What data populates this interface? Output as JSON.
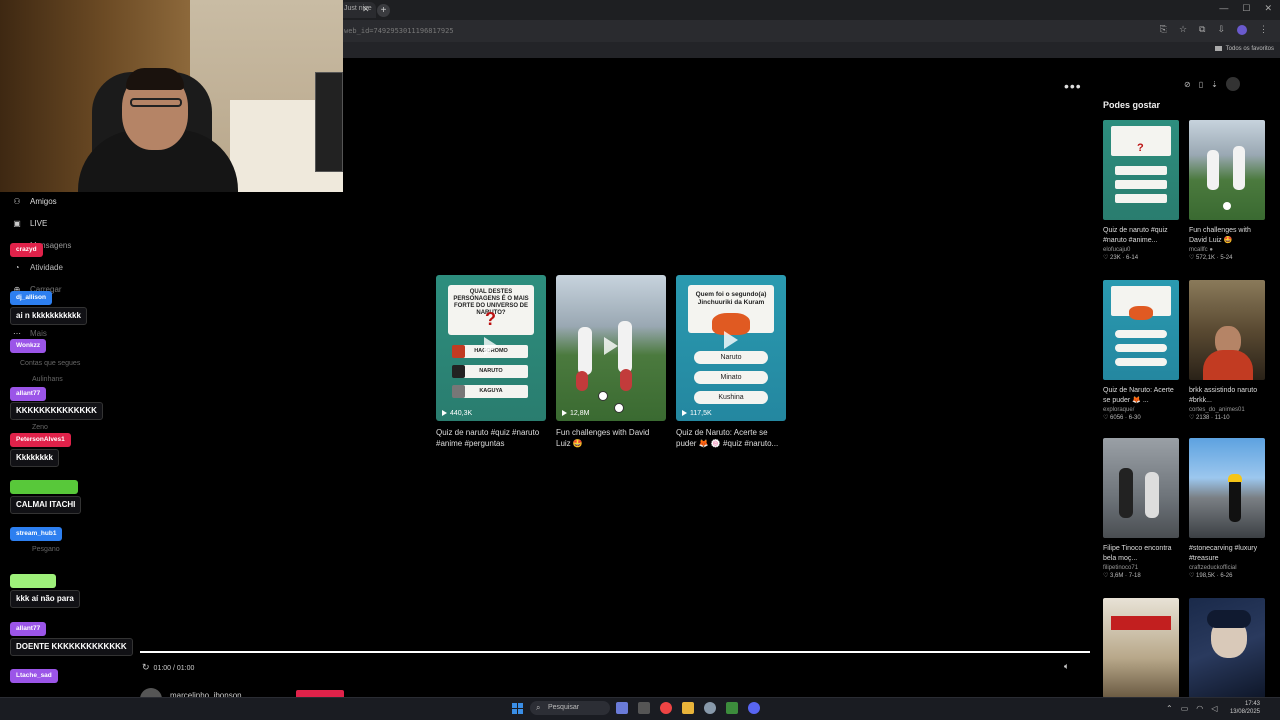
{
  "browser": {
    "tab_title": "Just nice",
    "url_fragment": "web_id=7492953011196817925",
    "bookmark_folder": "Todos os favoritos",
    "tab_close": "✕",
    "new_tab": "+"
  },
  "player": {
    "more_label": "•••",
    "time": "01:00 / 01:00",
    "uploader": "marcelinho_ibonson",
    "volume_icon": "speaker-icon"
  },
  "cards": [
    {
      "type": "quiz",
      "quiz_title": "QUAL DESTES PERSONAGENS É O MAIS FORTE DO UNIVERSO DE NARUTO?",
      "options": [
        "HAGOROMO",
        "NARUTO",
        "KAGUYA"
      ],
      "views": "440,3K",
      "title": "Quiz de naruto #quiz #naruto #anime #perguntas"
    },
    {
      "type": "field",
      "views": "12,8M",
      "title": "Fun challenges with David Luiz 🤩"
    },
    {
      "type": "quiz2",
      "quiz_title": "Quem foi o segundo(a) Jinchuuriki da Kuram",
      "options": [
        "Naruto",
        "Minato",
        "Kushina"
      ],
      "views": "117,5K",
      "title": "Quiz de Naruto: Acerte se puder 🦊 🍥 #quiz #naruto..."
    }
  ],
  "sidebar": {
    "title": "Podes gostar",
    "items": [
      {
        "title": "Quiz de naruto #quiz #naruto #anime...",
        "author": "elofucaju0",
        "stats": "♡ 23K · 6-14"
      },
      {
        "title": "Fun challenges with David Luiz 🤩",
        "author": "mcallfc ●",
        "stats": "♡ 572,1K · 5-24"
      },
      {
        "title": "Quiz de Naruto: Acerte se puder 🦊 ...",
        "author": "exploraque/",
        "stats": "♡ 6056 · 6-30"
      },
      {
        "title": "brkk assistindo naruto #brkk...",
        "author": "cortes_do_animes01",
        "stats": "♡ 2138 · 11-10"
      },
      {
        "title": "Filipe Tinoco encontra bela moç...",
        "author": "filipetinoco71",
        "stats": "♡ 3,6M · 7-18"
      },
      {
        "title": "#stonecarving #luxury #treasure",
        "author": "craftzeduckofficial",
        "stats": "♡ 198,5K · 6-26"
      }
    ]
  },
  "chat_nav": [
    {
      "label": "Amigos",
      "icon": "friends-icon",
      "glyph": "⚇"
    },
    {
      "label": "LIVE",
      "icon": "live-icon",
      "glyph": "▣"
    },
    {
      "label": "Mensagens",
      "icon": "messages-icon",
      "glyph": "✉"
    },
    {
      "label": "Atividade",
      "icon": "activity-icon",
      "glyph": "◔"
    },
    {
      "label": "Carregar",
      "icon": "upload-icon",
      "glyph": "⊕"
    },
    {
      "label": "Mais",
      "icon": "more-icon",
      "glyph": "⋯"
    }
  ],
  "chat_ghosts": [
    "Contas que segues",
    "Aulinhans",
    "Zeno",
    "Pesgano"
  ],
  "chat": [
    {
      "user": "crazyd",
      "color": "#e0224a",
      "message": ""
    },
    {
      "user": "dj_allison",
      "color": "#2d7ff0",
      "message": "ai n kkkkkkkkkkk"
    },
    {
      "user": "Wonkzz",
      "color": "#9b55e8",
      "message": ""
    },
    {
      "user": "allant77",
      "color": "#9b55e8",
      "message": "KKKKKKKKKKKKKK"
    },
    {
      "user": "PetersonAlves1",
      "color": "#e0224a",
      "message": "Kkkkkkkk"
    },
    {
      "user": "",
      "color": "#58c83a",
      "message": "CALMAI ITACHI"
    },
    {
      "user": "stream_hub1",
      "color": "#2d7ff0",
      "message": ""
    },
    {
      "user": "",
      "color": "#9ef07a",
      "message": "kkk aí não para"
    },
    {
      "user": "allant77",
      "color": "#9b55e8",
      "message": "DOENTE KKKKKKKKKKKKK"
    },
    {
      "user": "Ltache_sad",
      "color": "#9b55e8",
      "message": ""
    }
  ],
  "taskbar": {
    "search_placeholder": "Pesquisar",
    "time": "17:43",
    "date": "13/08/2025"
  }
}
